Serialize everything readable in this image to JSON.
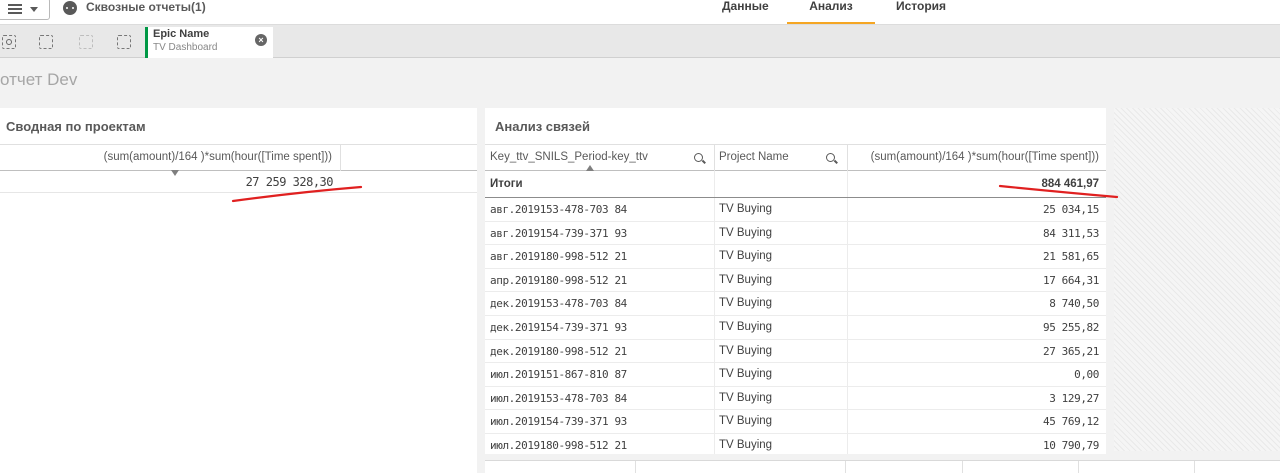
{
  "topbar": {
    "app_title": "Сквозные отчеты(1)",
    "tabs": [
      {
        "label": "Данные",
        "active": false
      },
      {
        "label": "Анализ",
        "active": true
      },
      {
        "label": "История",
        "active": false
      }
    ]
  },
  "selections": {
    "tools": [
      "smart-search-icon",
      "step-back-icon",
      "step-forward-icon",
      "clear-selections-icon"
    ],
    "chip": {
      "field": "Epic Name",
      "value": "TV Dashboard"
    }
  },
  "sheet": {
    "title": "отчет Dev"
  },
  "left_panel": {
    "title": "Сводная по проектам",
    "header": "(sum(amount)/164 )*sum(hour([Time spent]))",
    "total": "27 259 328,30"
  },
  "right_panel": {
    "title": "Анализ связей",
    "columns": [
      "Key_ttv_SNILS_Period-key_ttv",
      "Project Name",
      "(sum(amount)/164 )*sum(hour([Time spent]))"
    ],
    "totals_label": "Итоги",
    "totals_value": "884 461,97",
    "rows": [
      {
        "key": "авг.2019153-478-703 84",
        "project": "TV Buying",
        "value": "25 034,15"
      },
      {
        "key": "авг.2019154-739-371 93",
        "project": "TV Buying",
        "value": "84 311,53"
      },
      {
        "key": "авг.2019180-998-512 21",
        "project": "TV Buying",
        "value": "21 581,65"
      },
      {
        "key": "апр.2019180-998-512 21",
        "project": "TV Buying",
        "value": "17 664,31"
      },
      {
        "key": "дек.2019153-478-703 84",
        "project": "TV Buying",
        "value": "8 740,50"
      },
      {
        "key": "дек.2019154-739-371 93",
        "project": "TV Buying",
        "value": "95 255,82"
      },
      {
        "key": "дек.2019180-998-512 21",
        "project": "TV Buying",
        "value": "27 365,21"
      },
      {
        "key": "июл.2019151-867-810 87",
        "project": "TV Buying",
        "value": "0,00"
      },
      {
        "key": "июл.2019153-478-703 84",
        "project": "TV Buying",
        "value": "3 129,27"
      },
      {
        "key": "июл.2019154-739-371 93",
        "project": "TV Buying",
        "value": "45 769,12"
      },
      {
        "key": "июл.2019180-998-512 21",
        "project": "TV Buying",
        "value": "10 790,79"
      }
    ]
  },
  "colors": {
    "accent_tab": "#f5a623",
    "selection_green": "#009845",
    "annotation_red": "#e02020"
  }
}
